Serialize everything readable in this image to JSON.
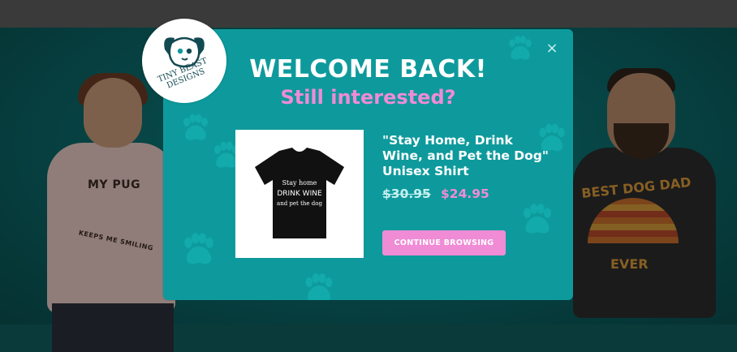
{
  "logo": {
    "text": "TINY BEAST DESIGNS"
  },
  "popup": {
    "title": "WELCOME BACK!",
    "subtitle": "Still interested?",
    "close_glyph": "×",
    "product": {
      "name": "\"Stay Home, Drink Wine, and Pet the Dog\" Unisex Shirt",
      "price_original": "$30.95",
      "price_sale": "$24.95",
      "shirt_print": {
        "line1": "Stay home",
        "line2": "DRINK WINE",
        "line3": "and pet the dog"
      }
    },
    "cta_label": "CONTINUE BROWSING",
    "colors": {
      "modal_bg": "#0e9a9c",
      "accent_pink": "#f08bd6"
    }
  },
  "background_models": {
    "left_shirt": {
      "line1": "MY PUG",
      "line2": "KEEPS ME SMILING"
    },
    "right_shirt": {
      "line1": "BEST DOG DAD",
      "line2": "EVER"
    }
  }
}
